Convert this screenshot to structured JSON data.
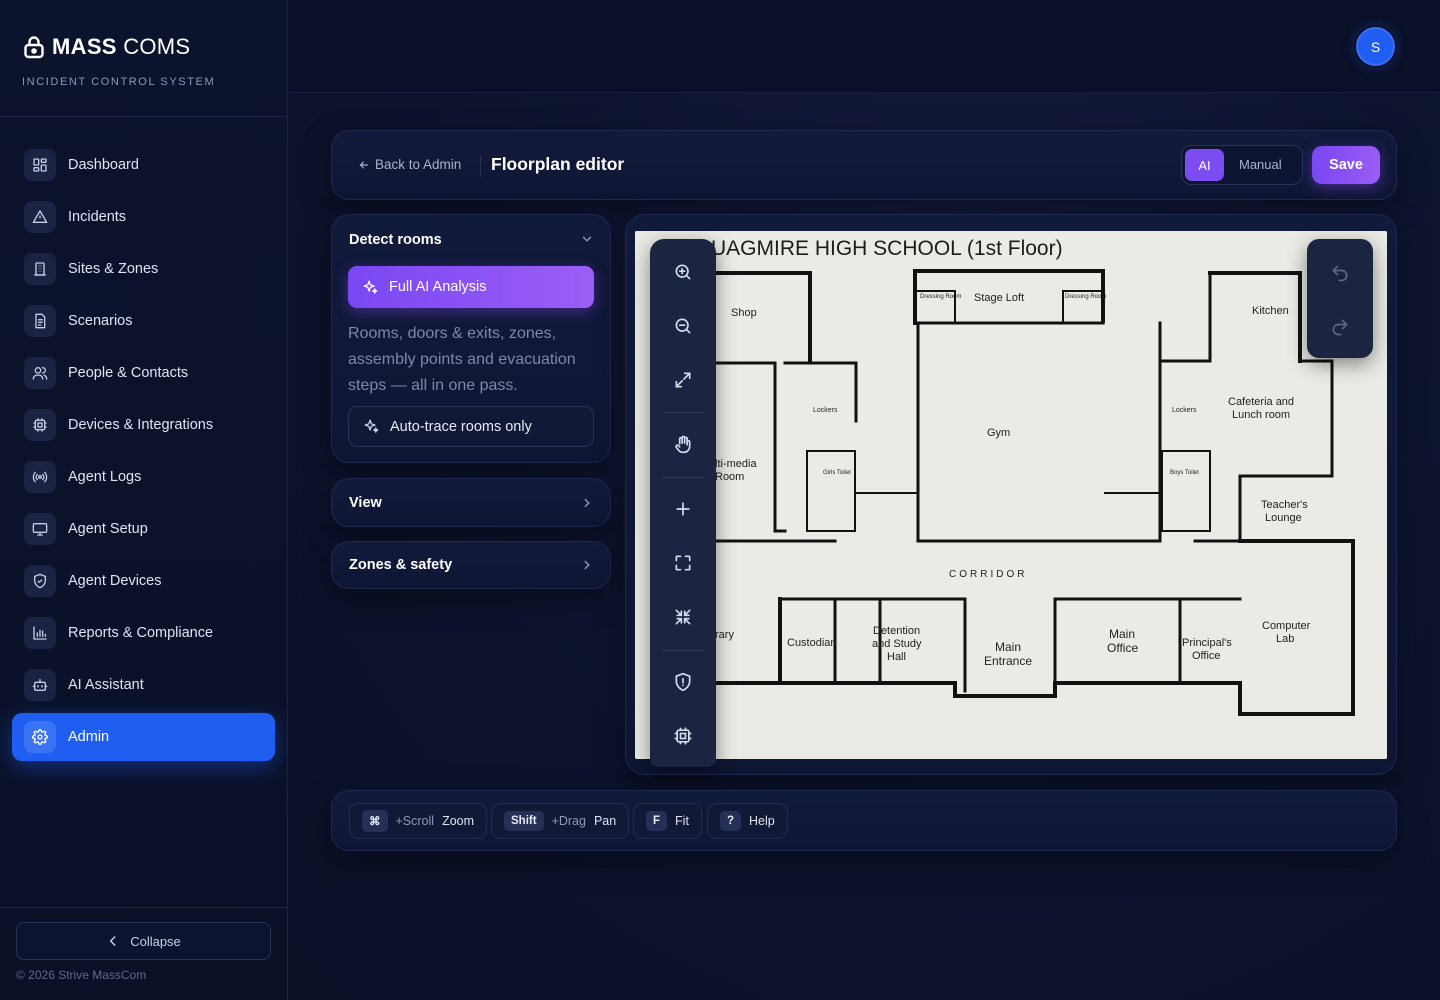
{
  "brand": {
    "title_bold": "MASS",
    "title_thin": "COMS",
    "subtitle": "INCIDENT CONTROL SYSTEM"
  },
  "sidebar": {
    "items": [
      {
        "label": "Dashboard",
        "icon": "dashboard-icon"
      },
      {
        "label": "Incidents",
        "icon": "alert-triangle-icon"
      },
      {
        "label": "Sites & Zones",
        "icon": "building-icon"
      },
      {
        "label": "Scenarios",
        "icon": "document-icon"
      },
      {
        "label": "People & Contacts",
        "icon": "users-icon"
      },
      {
        "label": "Devices & Integrations",
        "icon": "chip-icon"
      },
      {
        "label": "Agent Logs",
        "icon": "broadcast-icon"
      },
      {
        "label": "Agent Setup",
        "icon": "monitor-icon"
      },
      {
        "label": "Agent Devices",
        "icon": "shield-check-icon"
      },
      {
        "label": "Reports & Compliance",
        "icon": "bar-chart-icon"
      },
      {
        "label": "AI Assistant",
        "icon": "robot-icon"
      },
      {
        "label": "Admin",
        "icon": "gear-icon",
        "active": true
      }
    ],
    "collapse_label": "Collapse",
    "copyright": "© 2026 Strive MassCom"
  },
  "topbar": {
    "avatar_initial": "S"
  },
  "editor": {
    "back_label": "Back to Admin",
    "title": "Floorplan editor",
    "mode_ai": "AI",
    "mode_manual": "Manual",
    "save_label": "Save"
  },
  "detect": {
    "title": "Detect rooms",
    "full_ai_label": "Full AI Analysis",
    "description": "Rooms, doors & exits, zones, assembly points and evacuation steps — all in one pass.",
    "autotrace_label": "Auto-trace rooms only"
  },
  "view_panel": {
    "title": "View"
  },
  "zones_panel": {
    "title": "Zones & safety"
  },
  "floorplan": {
    "title": "UAGMIRE HIGH SCHOOL (1st Floor)",
    "rooms": {
      "shop": "Shop",
      "stage_loft": "Stage Loft",
      "dressing_left": "Dressing Room",
      "dressing_right": "Dressing Room",
      "kitchen": "Kitchen",
      "lockers_left": "Lockers",
      "lockers_right": "Lockers",
      "gym": "Gym",
      "cafeteria_1": "Cafeteria and",
      "cafeteria_2": "Lunch room",
      "multimedia_1": "lti-media",
      "multimedia_2": "Room",
      "girls_toilet": "Girls Toilet",
      "boys_toilet": "Boys Toilet",
      "teachers_1": "Teacher's",
      "teachers_2": "Lounge",
      "corridor": "CORRIDOR",
      "library": "rary",
      "custodian": "Custodian",
      "detention_1": "Detention",
      "detention_2": "and Study",
      "detention_3": "Hall",
      "main_entrance_1": "Main",
      "main_entrance_2": "Entrance",
      "main_office_1": "Main",
      "main_office_2": "Office",
      "principal_1": "Principal's",
      "principal_2": "Office",
      "computer_1": "Computer",
      "computer_2": "Lab"
    }
  },
  "tools": [
    "zoom-in-icon",
    "zoom-out-icon",
    "expand-icon",
    "hand-pan-icon",
    "plus-icon",
    "fit-frame-icon",
    "shrink-icon",
    "shield-alert-icon",
    "chip-icon"
  ],
  "shortcuts": [
    {
      "key": "⌘",
      "modifier": "+Scroll",
      "action": "Zoom"
    },
    {
      "key": "Shift",
      "modifier": "+Drag",
      "action": "Pan"
    },
    {
      "key": "F",
      "modifier": "",
      "action": "Fit"
    },
    {
      "key": "?",
      "modifier": "",
      "action": "Help"
    }
  ],
  "colors": {
    "accent_blue": "#1f5ef0",
    "accent_purple": "#7a47f2",
    "background": "#0b1128"
  }
}
